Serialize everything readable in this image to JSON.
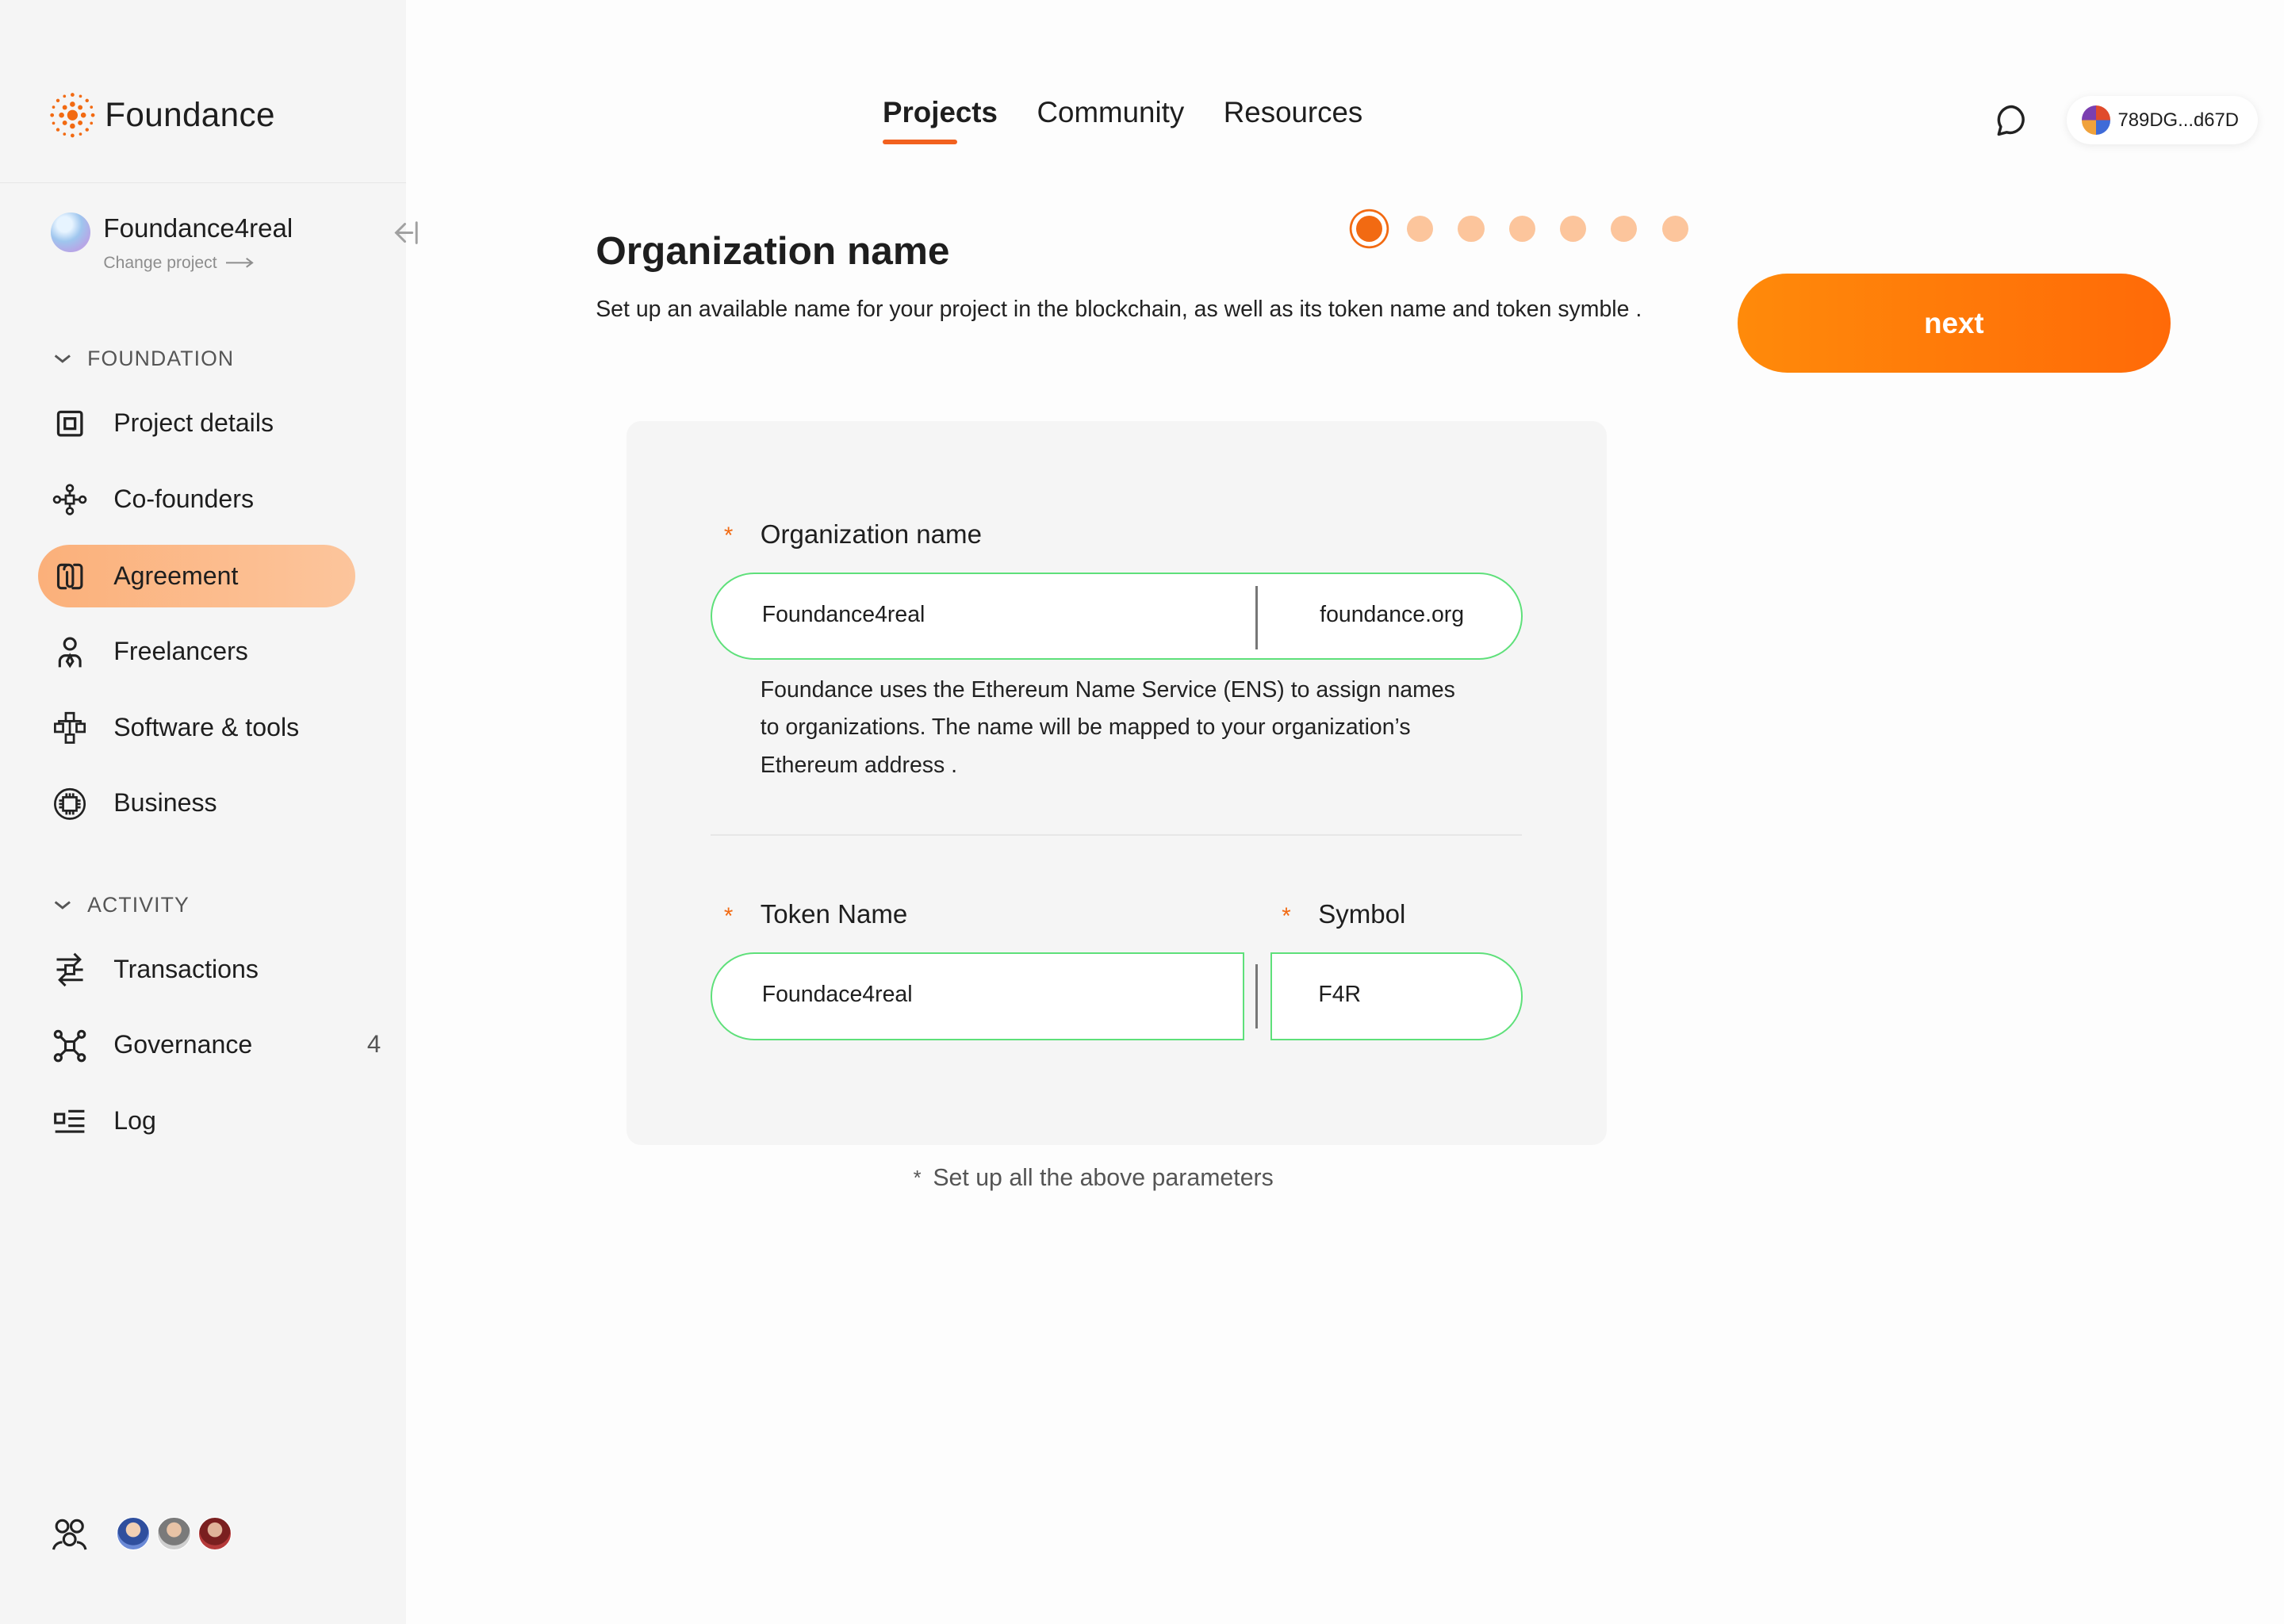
{
  "brand": {
    "name": "Foundance"
  },
  "project": {
    "name": "Foundance4real",
    "change_label": "Change project"
  },
  "sidebar": {
    "sections": [
      {
        "title": "FOUNDATION"
      },
      {
        "title": "ACTIVITY"
      }
    ],
    "foundation_items": [
      {
        "label": "Project details",
        "icon": "square-frame-icon"
      },
      {
        "label": "Co-founders",
        "icon": "network-nodes-icon"
      },
      {
        "label": "Agreement",
        "icon": "linked-docs-icon",
        "active": true
      },
      {
        "label": "Freelancers",
        "icon": "person-tie-icon"
      },
      {
        "label": "Software & tools",
        "icon": "hierarchy-icon"
      },
      {
        "label": "Business",
        "icon": "chip-globe-icon"
      }
    ],
    "activity_items": [
      {
        "label": "Transactions",
        "icon": "transfer-icon"
      },
      {
        "label": "Governance",
        "icon": "governance-icon",
        "badge": "4"
      },
      {
        "label": "Log",
        "icon": "log-list-icon"
      }
    ]
  },
  "header": {
    "tabs": [
      {
        "label": "Projects",
        "active": true
      },
      {
        "label": "Community"
      },
      {
        "label": "Resources"
      }
    ],
    "wallet": "789DG...d67D"
  },
  "main": {
    "title": "Organization name",
    "description": "Set up an available name for your project in the blockchain, as well as its token name and token symble .",
    "next_label": "next",
    "steps": {
      "total": 7,
      "current": 1
    },
    "form": {
      "org_label": "Organization name",
      "org_value": "Foundance4real",
      "org_domain": "foundance.org",
      "org_help": "Foundance uses the Ethereum Name Service (ENS) to assign names to organizations. The name will be mapped to your organization’s Ethereum address .",
      "token_label": "Token Name",
      "token_value": "Foundace4real",
      "symbol_label": "Symbol",
      "symbol_value": "F4R",
      "required_mark": "*"
    },
    "footnote": "Set up all the above parameters",
    "footnote_mark": "*"
  },
  "colors": {
    "accent": "#f26a12",
    "active_nav": "#fbb07a",
    "input_border": "#5ee07a",
    "step_inactive": "#fcc59c"
  }
}
